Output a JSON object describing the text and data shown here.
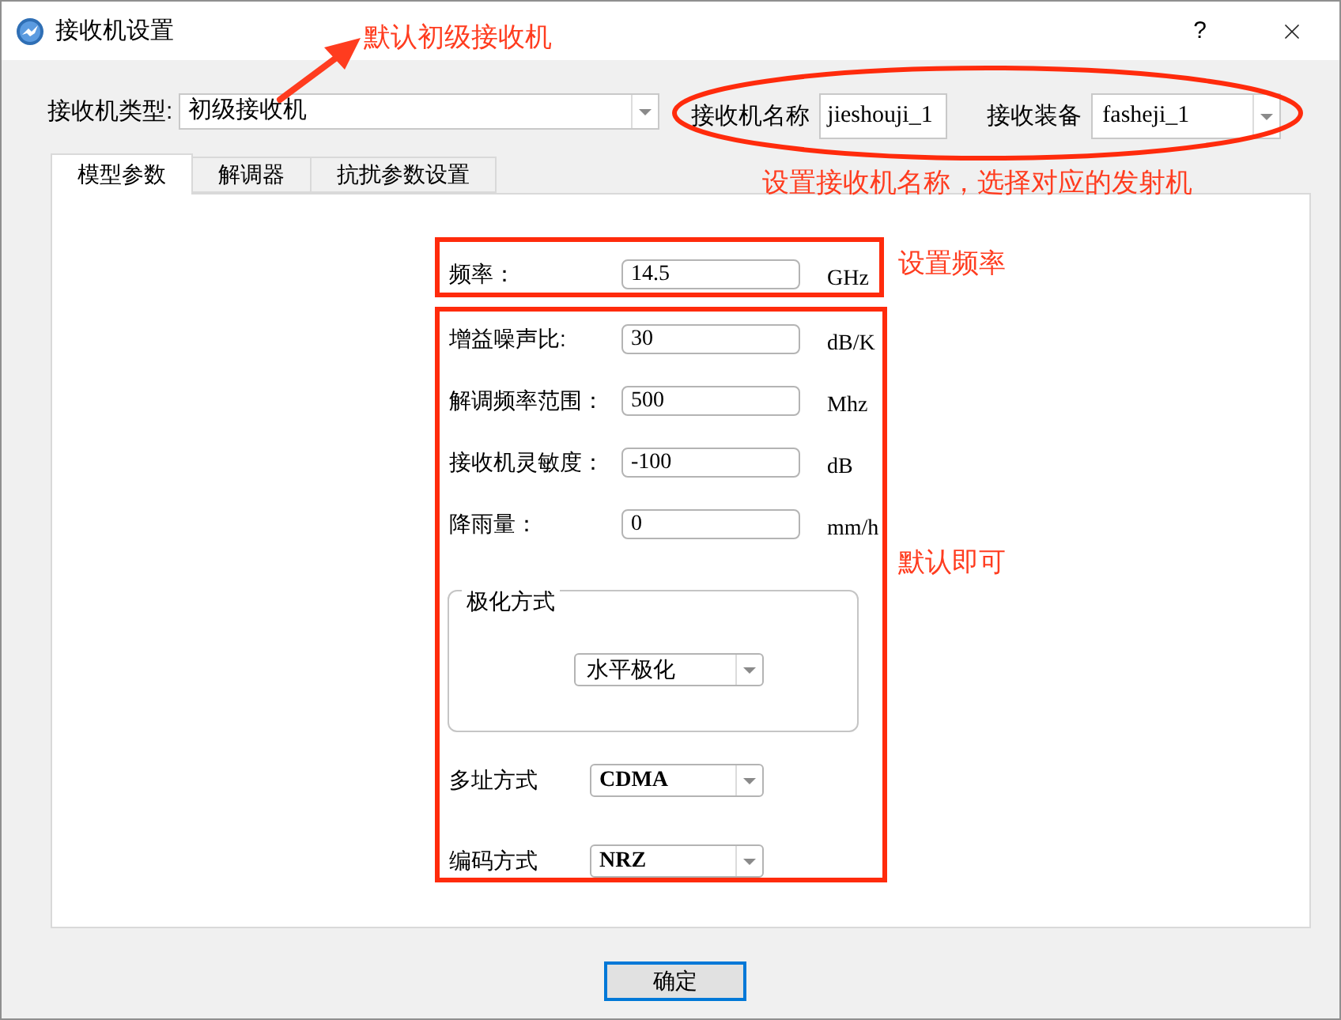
{
  "window": {
    "title": "接收机设置",
    "help": "?"
  },
  "header": {
    "receiver_type": {
      "label": "接收机类型:",
      "value": "初级接收机"
    },
    "receiver_name": {
      "label": "接收机名称",
      "value": "jieshouji_1"
    },
    "receiver_equipment": {
      "label": "接收装备",
      "value": "fasheji_1"
    }
  },
  "tabs": [
    {
      "label": "模型参数",
      "selected": true
    },
    {
      "label": "解调器",
      "selected": false
    },
    {
      "label": "抗扰参数设置",
      "selected": false
    }
  ],
  "frequency": {
    "label": "频率：",
    "value": "14.5",
    "unit": "GHz"
  },
  "parameters": [
    {
      "label": "增益噪声比:",
      "value": "30",
      "unit": "dB/K"
    },
    {
      "label": "解调频率范围：",
      "value": "500",
      "unit": "Mhz"
    },
    {
      "label": "接收机灵敏度：",
      "value": "-100",
      "unit": "dB"
    },
    {
      "label": "降雨量：",
      "value": "0",
      "unit": "mm/h"
    }
  ],
  "polarization": {
    "title": "极化方式",
    "value": "水平极化"
  },
  "selects": [
    {
      "label": "多址方式",
      "value": "CDMA"
    },
    {
      "label": "编码方式",
      "value": "NRZ"
    }
  ],
  "ok_button": {
    "label": "确定",
    "focused": true
  },
  "annotations": {
    "receiver_type_note": "默认初级接收机",
    "header_note": "设置接收机名称，选择对应的发射机",
    "frequency_note": "设置频率",
    "defaults_note": "默认即可"
  }
}
